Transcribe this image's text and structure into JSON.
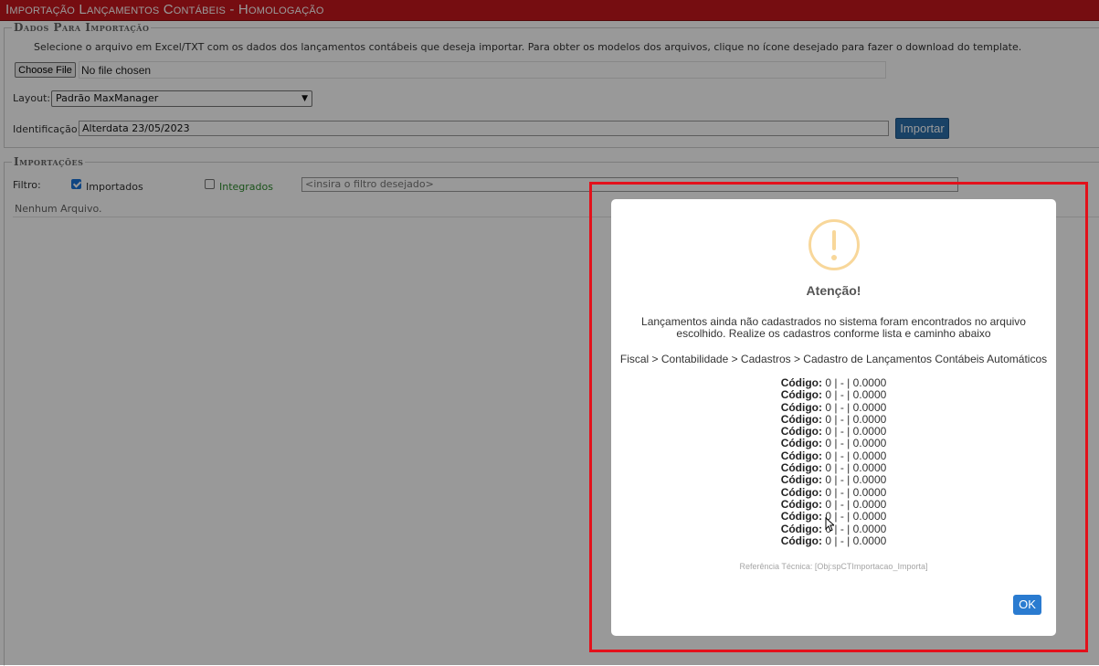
{
  "window": {
    "title": "Importação Lançamentos Contábeis  - Homologação"
  },
  "dados": {
    "legend": "Dados Para Importação",
    "instructions": "Selecione o arquivo em Excel/TXT com os dados dos lançamentos contábeis que deseja importar. Para obter os modelos dos arquivos, clique no ícone desejado para fazer o download do template.",
    "file_button": "Choose File",
    "file_status": "No file chosen",
    "layout_label": "Layout:",
    "layout_value": "Padrão MaxManager",
    "identificacao_label": "Identificação:",
    "identificacao_value": "Alterdata 23/05/2023",
    "import_button": "Importar"
  },
  "importacoes": {
    "legend": "Importações",
    "filter_label": "Filtro:",
    "importados_label": "Importados",
    "importados_checked": true,
    "integrados_label": "Integrados",
    "integrados_checked": false,
    "filter_placeholder": "<insira o filtro desejado>",
    "empty_text": "Nenhum Arquivo."
  },
  "dialog": {
    "icon": "warning-exclamation-icon",
    "icon_color": "#f8d79a",
    "title": "Atenção!",
    "message": "Lançamentos ainda não cadastrados no sistema foram encontrados no arquivo escolhido. Realize os cadastros conforme lista e caminho abaixo",
    "path": "Fiscal > Contabilidade > Cadastros > Cadastro de Lançamentos Contábeis Automáticos",
    "codes": [
      {
        "label": "Código:",
        "value": "0 | - | 0.0000"
      },
      {
        "label": "Código:",
        "value": "0 | - | 0.0000"
      },
      {
        "label": "Código:",
        "value": "0 | - | 0.0000"
      },
      {
        "label": "Código:",
        "value": "0 | - | 0.0000"
      },
      {
        "label": "Código:",
        "value": "0 | - | 0.0000"
      },
      {
        "label": "Código:",
        "value": "0 | - | 0.0000"
      },
      {
        "label": "Código:",
        "value": "0 | - | 0.0000"
      },
      {
        "label": "Código:",
        "value": "0 | - | 0.0000"
      },
      {
        "label": "Código:",
        "value": "0 | - | 0.0000"
      },
      {
        "label": "Código:",
        "value": "0 | - | 0.0000"
      },
      {
        "label": "Código:",
        "value": "0 | - | 0.0000"
      },
      {
        "label": "Código:",
        "value": "0 | - | 0.0000"
      },
      {
        "label": "Código:",
        "value": "0 | - | 0.0000"
      },
      {
        "label": "Código:",
        "value": "0 | - | 0.0000"
      }
    ],
    "reference": "Referência Técnica: [Obj:spCTImportacao_Importa]",
    "ok_button": "OK"
  },
  "colors": {
    "titlebar": "#c5171d",
    "primary_button": "#2a6fab",
    "ok_button": "#2a7bd0",
    "highlight_border": "#e3111b",
    "integrados_text": "#2e8b2e"
  }
}
